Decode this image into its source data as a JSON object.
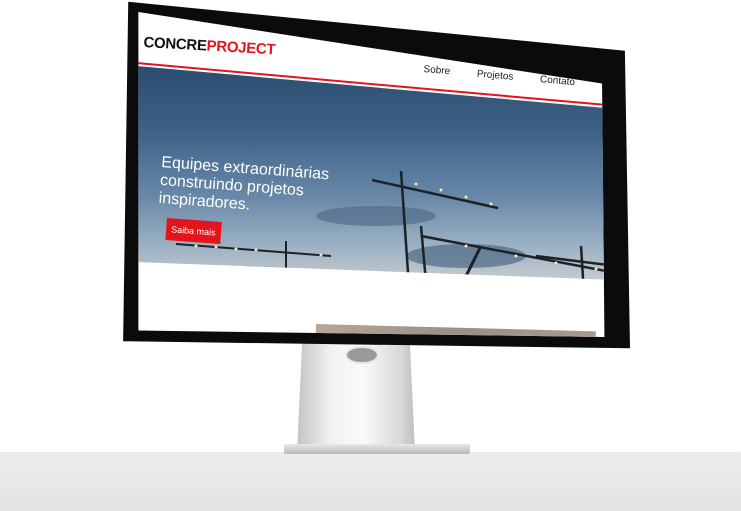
{
  "site": {
    "brand_part1": "CONCRE",
    "brand_part2": "PROJECT",
    "brand_color": "#e3141b",
    "nav": [
      "Sobre",
      "Projetos",
      "Contato"
    ],
    "hero": {
      "headline_lines": [
        "Equipes extraordinárias",
        "construindo projetos",
        "inspiradores."
      ],
      "cta_label": "Saiba mais",
      "image_subject": "construction cranes at dusk"
    }
  },
  "device": {
    "type": "desktop monitor mockup"
  }
}
